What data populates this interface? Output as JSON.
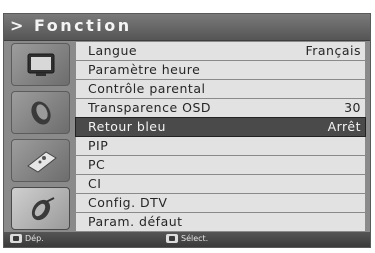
{
  "header": {
    "title": "> Fonction"
  },
  "sidebar": {
    "icons": [
      {
        "name": "tv-screen-icon",
        "active": false
      },
      {
        "name": "satellite-dish-icon",
        "active": false
      },
      {
        "name": "remote-control-icon",
        "active": false
      },
      {
        "name": "satellite-icon",
        "active": true
      }
    ]
  },
  "menu": {
    "items": [
      {
        "label": "Langue",
        "value": "Français"
      },
      {
        "label": "Paramètre heure",
        "value": ""
      },
      {
        "label": "Contrôle parental",
        "value": ""
      },
      {
        "label": "Transparence OSD",
        "value": "30"
      },
      {
        "label": "Retour bleu",
        "value": "Arrêt",
        "selected": true
      },
      {
        "label": "PIP",
        "value": ""
      },
      {
        "label": "PC",
        "value": ""
      },
      {
        "label": "CI",
        "value": ""
      },
      {
        "label": "Config. DTV",
        "value": ""
      },
      {
        "label": "Param. défaut",
        "value": ""
      }
    ]
  },
  "footer": {
    "move_label": "Dép.",
    "select_label": "Sélect."
  },
  "colors": {
    "panel": "#8a8a8a",
    "row": "#e2e2e2",
    "row_selected": "#4a4a4a",
    "title_bar": "#5a5a5a"
  }
}
